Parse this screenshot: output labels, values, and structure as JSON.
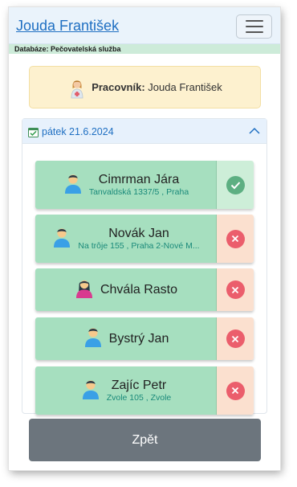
{
  "app": {
    "title": "Jouda František",
    "menu_icon": "hamburger-icon"
  },
  "database": {
    "label": "Databáze: Pečovatelská služba"
  },
  "worker": {
    "label": "Pracovník:",
    "name": "Jouda František",
    "icon": "nurse-avatar-icon"
  },
  "day": {
    "date_label": "pátek 21.6.2024",
    "expanded": true
  },
  "visits": [
    {
      "name": "Cimrman Jára",
      "address": "Tanvaldská 1337/5 , Praha",
      "gender": "male",
      "status": "done"
    },
    {
      "name": "Novák Jan",
      "address": "Na trôje 155 , Praha 2-Nové M...",
      "gender": "male",
      "status": "missed"
    },
    {
      "name": "Chvála Rasto",
      "address": "",
      "gender": "female",
      "status": "missed"
    },
    {
      "name": "Bystrý Jan",
      "address": "",
      "gender": "male",
      "status": "missed"
    },
    {
      "name": "Zajíc Petr",
      "address": "Zvole 105 , Zvole",
      "gender": "male",
      "status": "missed"
    }
  ],
  "footer": {
    "back_label": "Zpět"
  },
  "colors": {
    "visit_bg": "#a6dfbf",
    "status_missed_bg": "#fbe0cf",
    "status_done_bg": "#cdeed8",
    "missed_icon": "#eb5e6c",
    "done_icon": "#5daf82",
    "back_button": "#6c757d"
  }
}
